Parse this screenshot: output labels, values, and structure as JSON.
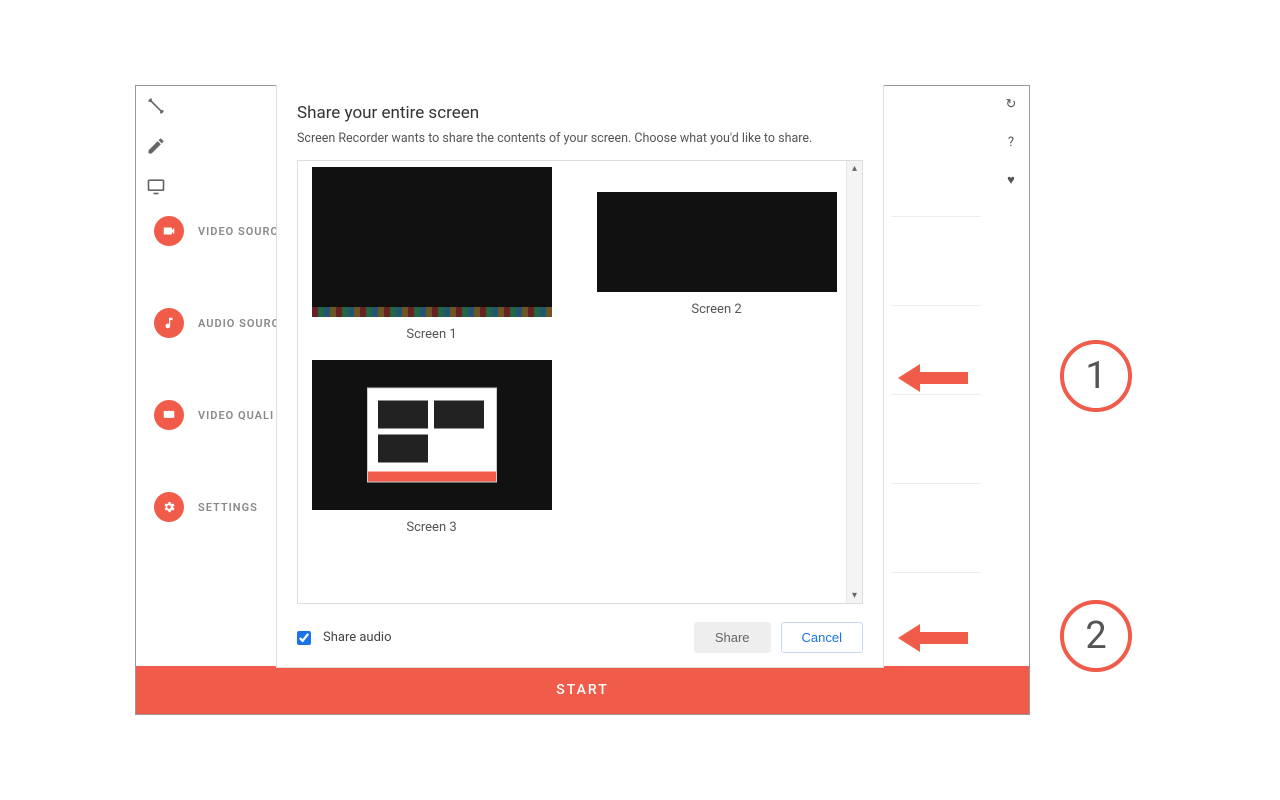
{
  "nav": {
    "items": [
      {
        "label": "VIDEO SOURC"
      },
      {
        "label": "AUDIO SOURC"
      },
      {
        "label": "VIDEO QUALI"
      },
      {
        "label": "SETTINGS"
      }
    ]
  },
  "start_button": "START",
  "dialog": {
    "title": "Share your entire screen",
    "description": "Screen Recorder wants to share the contents of your screen. Choose what you'd like to share.",
    "screens": [
      {
        "label": "Screen 1"
      },
      {
        "label": "Screen 2"
      },
      {
        "label": "Screen 3"
      }
    ],
    "share_audio_label": "Share audio",
    "share_audio_checked": true,
    "share_button": "Share",
    "cancel_button": "Cancel"
  },
  "annotations": {
    "marker1": "1",
    "marker2": "2"
  }
}
